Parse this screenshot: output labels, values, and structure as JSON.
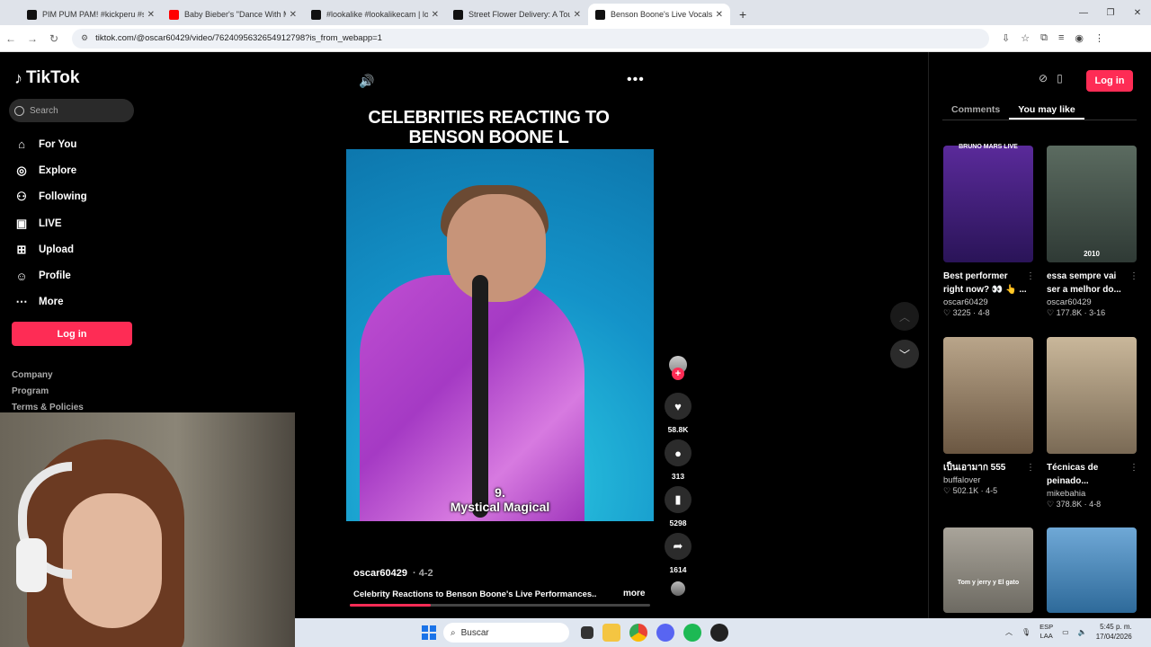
{
  "browser": {
    "tabs": [
      {
        "title": "PIM PUM PAM! #kickperu #stre",
        "fav_color": "#111111"
      },
      {
        "title": "Baby Bieber's \"Dance With Mo",
        "fav_color": "#ff0000"
      },
      {
        "title": "#lookalike #lookalikecam | look",
        "fav_color": "#111111"
      },
      {
        "title": "Street Flower Delivery: A Touch",
        "fav_color": "#111111"
      },
      {
        "title": "Benson Boone's Live Vocals Sp",
        "fav_color": "#111111"
      }
    ],
    "url": "tiktok.com/@oscar60429/video/7624095632654912798?is_from_webapp=1"
  },
  "sidebar": {
    "logo": "TikTok",
    "search_placeholder": "Search",
    "items": [
      {
        "label": "For You",
        "icon": "home-icon"
      },
      {
        "label": "Explore",
        "icon": "compass-icon"
      },
      {
        "label": "Following",
        "icon": "person-icon"
      },
      {
        "label": "LIVE",
        "icon": "live-icon"
      },
      {
        "label": "Upload",
        "icon": "plus-box-icon"
      },
      {
        "label": "Profile",
        "icon": "profile-icon"
      },
      {
        "label": "More",
        "icon": "ellipsis-icon"
      }
    ],
    "login": "Log in",
    "footer": [
      "Company",
      "Program",
      "Terms & Policies"
    ]
  },
  "video": {
    "title_line1": "CELEBRITIES REACTING TO",
    "title_line2": "BENSON BOONE L",
    "caption_number": "9.",
    "caption_text": "Mystical Magical",
    "author": "oscar60429",
    "date": "4-2",
    "description": "Celebrity Reactions to Benson Boone's Live Performances...",
    "more": "more",
    "progress": 0.27,
    "likes": "58.8K",
    "comments": "313",
    "saves": "5298",
    "shares": "1614"
  },
  "right_panel": {
    "login": "Log in",
    "tabs": [
      "Comments",
      "You may like"
    ],
    "cards": [
      {
        "title": "Best performer right now? 👀 👆 ...",
        "user": "oscar60429",
        "likes": "3225",
        "date": "4-8",
        "thumb_text": "BRUNO MARS LIVE",
        "color1": "#5a2a9a",
        "color2": "#2a1458"
      },
      {
        "title": "essa sempre vai ser a melhor do...",
        "user": "oscar60429",
        "likes": "177.8K",
        "date": "3-16",
        "thumb_text": "2010",
        "color1": "#5b6b60",
        "color2": "#2f3a35"
      },
      {
        "title": "เป็นเอามาก 555",
        "user": "buffalover",
        "likes": "502.1K",
        "date": "4-5",
        "thumb_text": "",
        "color1": "#b9a58a",
        "color2": "#6b5742"
      },
      {
        "title": "Técnicas de peinado...",
        "user": "mikebahia",
        "likes": "378.8K",
        "date": "4-8",
        "thumb_text": "",
        "color1": "#c9b79a",
        "color2": "#7a6a55"
      },
      {
        "title": "",
        "user": "",
        "likes": "",
        "date": "",
        "thumb_text": "Tom y jerry y El gato",
        "color1": "#a9a49a",
        "color2": "#6d6a62"
      },
      {
        "title": "",
        "user": "",
        "likes": "",
        "date": "",
        "thumb_text": "",
        "color1": "#6fa8d6",
        "color2": "#2e6a9a"
      }
    ]
  },
  "taskbar": {
    "search": "Buscar",
    "lang1": "ESP",
    "lang2": "LAA",
    "time": "5:45 p. m.",
    "date": "17/04/2026"
  }
}
